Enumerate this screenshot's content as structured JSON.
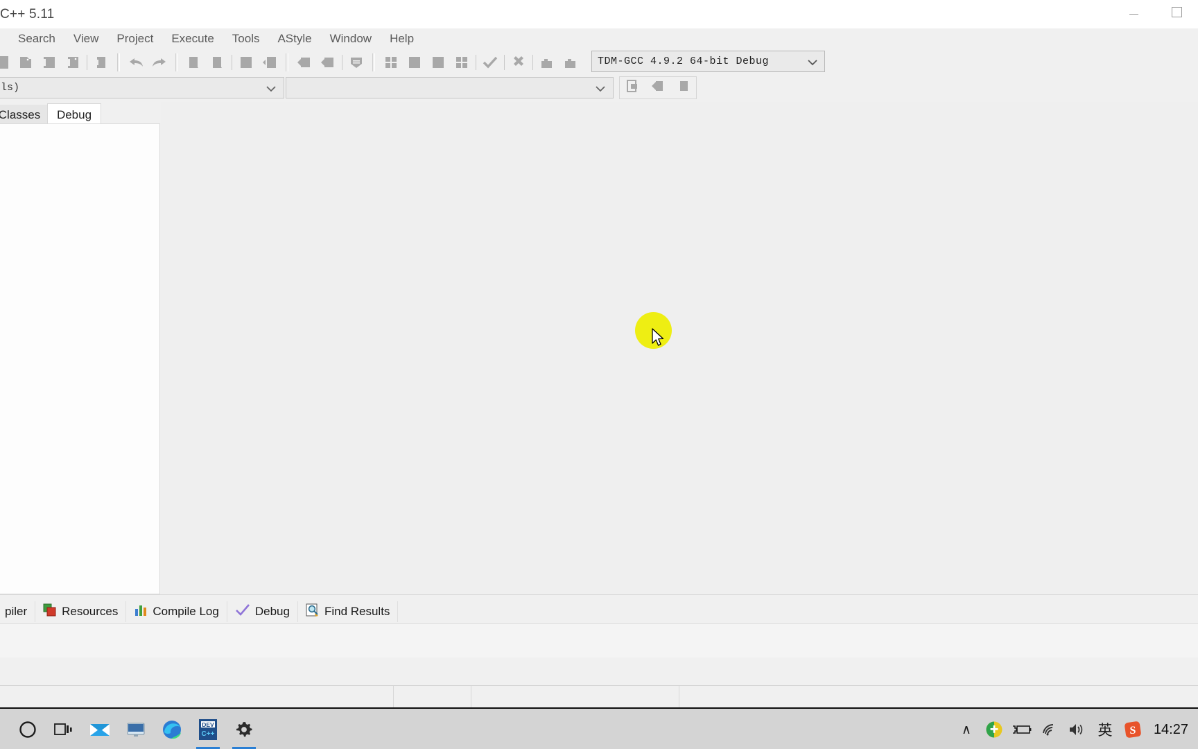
{
  "window": {
    "title": "C++ 5.11",
    "minimize_label": "Minimize",
    "maximize_label": "Maximize"
  },
  "menu": {
    "items": [
      {
        "label": "",
        "name": "menu-edit-clipped"
      },
      {
        "label": "Search",
        "name": "menu-search"
      },
      {
        "label": "View",
        "name": "menu-view"
      },
      {
        "label": "Project",
        "name": "menu-project"
      },
      {
        "label": "Execute",
        "name": "menu-execute"
      },
      {
        "label": "Tools",
        "name": "menu-tools"
      },
      {
        "label": "AStyle",
        "name": "menu-astyle"
      },
      {
        "label": "Window",
        "name": "menu-window"
      },
      {
        "label": "Help",
        "name": "menu-help"
      }
    ]
  },
  "toolbar": {
    "compiler_select": {
      "value": "TDM-GCC 4.9.2 64-bit Debug",
      "name": "compiler-profile-select"
    },
    "buttons": [
      "new-file-button",
      "open-file-button",
      "save-file-button",
      "save-all-button",
      "close-file-button",
      "undo-button",
      "redo-button",
      "cut-button",
      "copy-button",
      "paste-button",
      "insert-button",
      "print-button",
      "print-preview-button",
      "find-button",
      "compile-button",
      "run-button",
      "stop-button",
      "compile-run-button",
      "debug-check-button",
      "abort-button",
      "profile-button",
      "rebuild-button"
    ]
  },
  "toolbar2": {
    "scope_select": {
      "value": "ls)",
      "name": "class-scope-select"
    },
    "symbol_select": {
      "value": "",
      "name": "symbol-select"
    },
    "nav_buttons": [
      "goto-declaration-button",
      "nav-back-button",
      "nav-forward-button"
    ]
  },
  "left_tabs": [
    {
      "label": "Classes",
      "active": false
    },
    {
      "label": "Debug",
      "active": true
    }
  ],
  "bottom_tabs": [
    {
      "label": "piler",
      "icon": "compiler-icon",
      "active": false
    },
    {
      "label": "Resources",
      "icon": "resources-icon",
      "active": false
    },
    {
      "label": "Compile Log",
      "icon": "compile-log-icon",
      "active": false
    },
    {
      "label": "Debug",
      "icon": "debug-check-icon",
      "active": false
    },
    {
      "label": "Find Results",
      "icon": "find-results-icon",
      "active": false
    }
  ],
  "statusbar": {
    "cells": [
      "",
      "",
      "",
      ""
    ]
  },
  "taskbar": {
    "icons": [
      {
        "name": "cortana-icon",
        "label": "Cortana",
        "active": false
      },
      {
        "name": "task-view-icon",
        "label": "Task View",
        "active": false
      },
      {
        "name": "mail-icon",
        "label": "Mail",
        "active": false
      },
      {
        "name": "desktop-icon",
        "label": "Desktop",
        "active": false
      },
      {
        "name": "edge-icon",
        "label": "Microsoft Edge",
        "active": false
      },
      {
        "name": "devcpp-icon",
        "label": "DEV",
        "active": true
      },
      {
        "name": "settings-gear-icon",
        "label": "Settings",
        "active": true
      }
    ],
    "tray": [
      {
        "name": "show-hidden-icons-chevron",
        "glyph": "∧"
      },
      {
        "name": "security-shield-icon",
        "glyph": ""
      },
      {
        "name": "battery-icon",
        "glyph": ""
      },
      {
        "name": "wifi-icon",
        "glyph": ""
      },
      {
        "name": "volume-icon",
        "glyph": ""
      },
      {
        "name": "ime-language-icon",
        "glyph": "英"
      },
      {
        "name": "sogou-input-icon",
        "glyph": "S"
      }
    ],
    "clock": "14:27"
  },
  "colors": {
    "accent": "#2a7fd4",
    "click_highlight": "#eeee13",
    "window_bg": "#efefef",
    "toolbar_bg": "#f0f0f0",
    "taskbar_bg": "#d4d4d4"
  }
}
